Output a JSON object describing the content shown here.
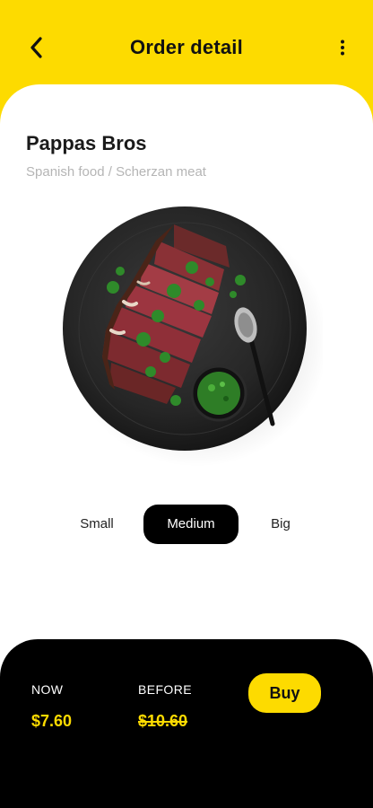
{
  "header": {
    "title": "Order detail",
    "back_icon": "chevron-left-icon",
    "menu_icon": "more-vertical-icon",
    "background_color": "#FDDB00"
  },
  "restaurant": {
    "name": "Pappas Bros",
    "category": "Spanish food / Scherzan meat"
  },
  "dish_image": {
    "icon": "steak-plate-image"
  },
  "sizes": {
    "options": [
      "Small",
      "Medium",
      "Big"
    ],
    "selected": "Medium"
  },
  "checkout": {
    "now_label": "NOW",
    "now_price": "$7.60",
    "before_label": "BEFORE",
    "before_price": "$10.60",
    "buy_label": "Buy",
    "accent_color": "#FDDB00"
  }
}
